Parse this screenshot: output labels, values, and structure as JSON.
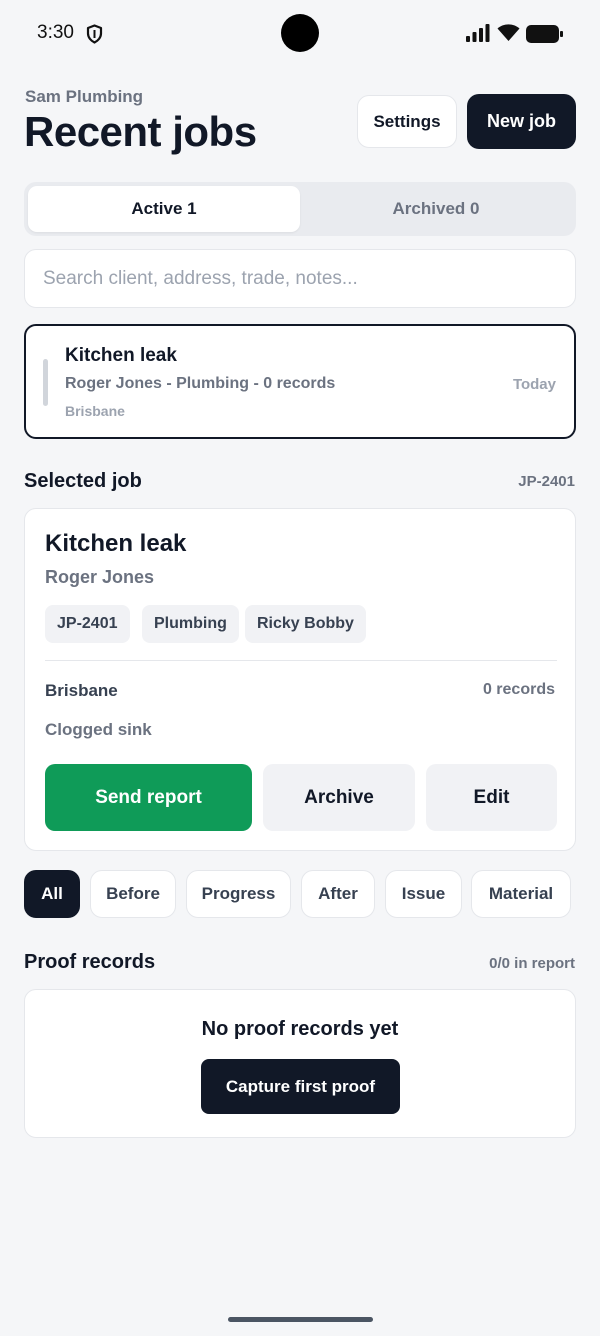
{
  "status_bar": {
    "time": "3:30"
  },
  "header": {
    "business": "Sam Plumbing",
    "title": "Recent jobs",
    "settings_label": "Settings",
    "new_job_label": "New job"
  },
  "tabs": [
    {
      "label": "Active 1",
      "selected": true
    },
    {
      "label": "Archived 0",
      "selected": false
    }
  ],
  "search": {
    "placeholder": "Search client, address, trade, notes..."
  },
  "job_list": [
    {
      "title": "Kitchen leak",
      "meta": "Roger Jones - Plumbing - 0 records",
      "location": "Brisbane",
      "date": "Today"
    }
  ],
  "selected_job": {
    "section_title": "Selected job",
    "id": "JP-2401",
    "title": "Kitchen leak",
    "client": "Roger Jones",
    "chips": [
      "JP-2401",
      "Plumbing",
      "Ricky Bobby"
    ],
    "location": "Brisbane",
    "records": "0 records",
    "notes": "Clogged sink",
    "actions": {
      "send_report": "Send report",
      "archive": "Archive",
      "edit": "Edit"
    },
    "colors": {
      "send_report": "#0f9b58"
    }
  },
  "filters": [
    {
      "label": "All",
      "selected": true
    },
    {
      "label": "Before",
      "selected": false
    },
    {
      "label": "Progress",
      "selected": false
    },
    {
      "label": "After",
      "selected": false
    },
    {
      "label": "Issue",
      "selected": false
    },
    {
      "label": "Material",
      "selected": false
    }
  ],
  "proof_records": {
    "title": "Proof records",
    "count": "0/0 in report",
    "empty_text": "No proof records yet",
    "capture_label": "Capture first proof"
  }
}
